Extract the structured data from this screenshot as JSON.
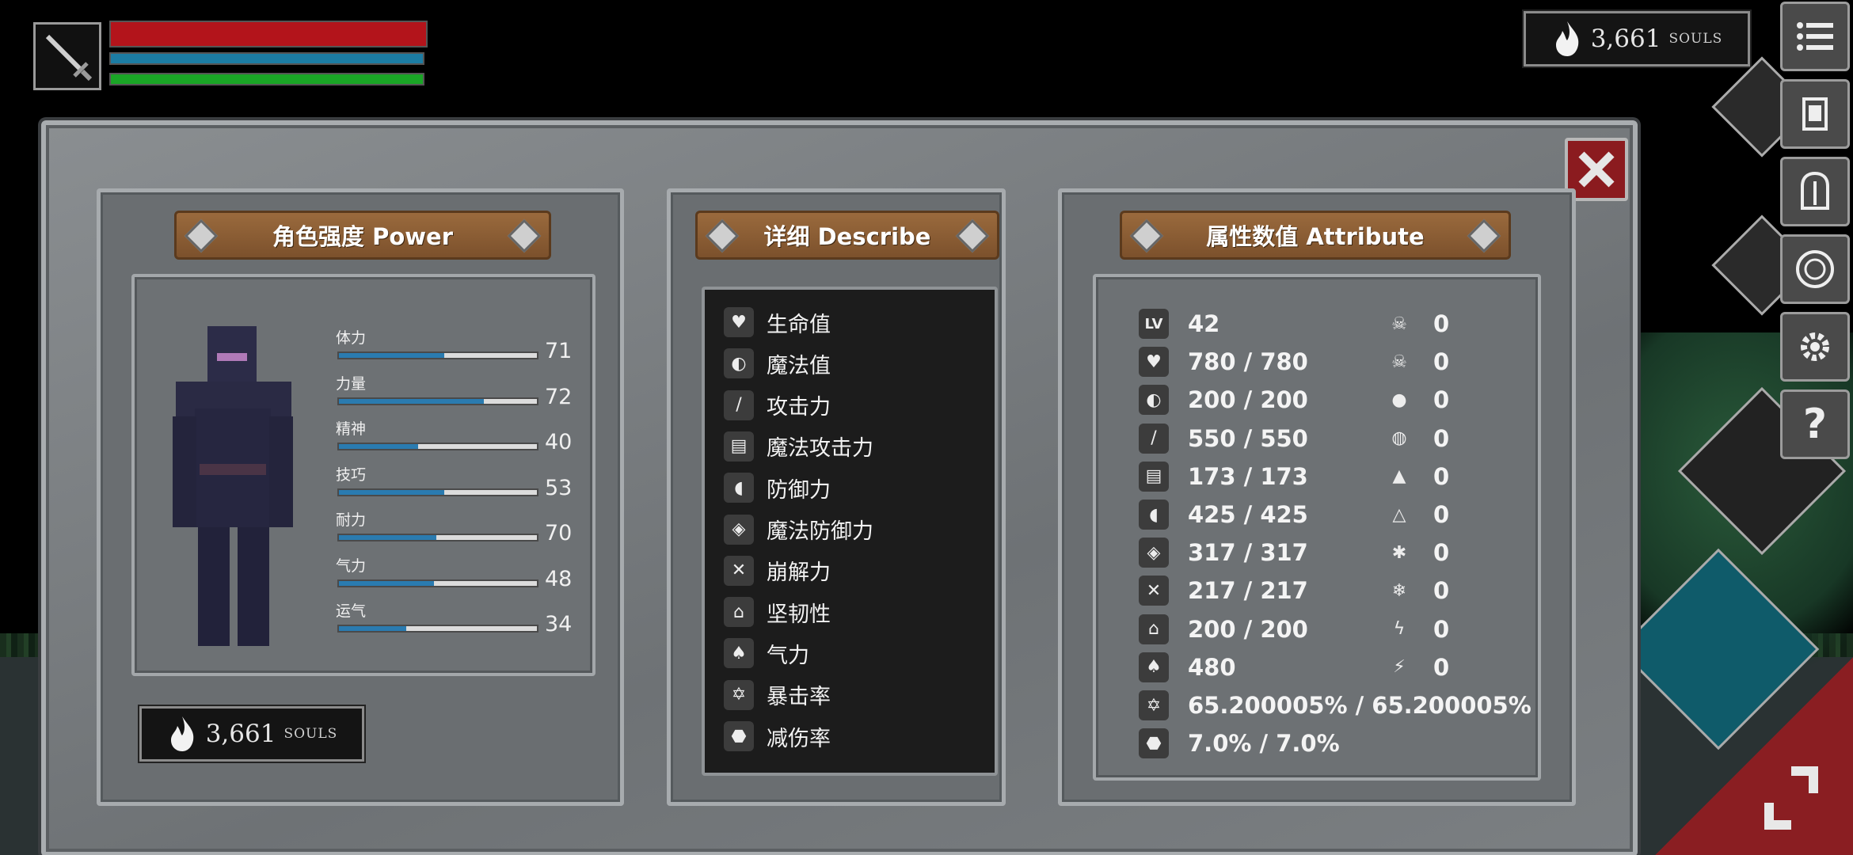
{
  "souls": {
    "value": "3,661",
    "label": "SOULS"
  },
  "hud": {
    "hp_fraction": 1.0,
    "mp_fraction": 1.0,
    "sp_fraction": 1.0
  },
  "power_panel": {
    "title": "角色强度 Power",
    "stats": [
      {
        "label": "体力",
        "value": "71",
        "fill": 0.53
      },
      {
        "label": "力量",
        "value": "72",
        "fill": 0.73
      },
      {
        "label": "精神",
        "value": "40",
        "fill": 0.4
      },
      {
        "label": "技巧",
        "value": "53",
        "fill": 0.53
      },
      {
        "label": "耐力",
        "value": "70",
        "fill": 0.49
      },
      {
        "label": "气力",
        "value": "48",
        "fill": 0.48
      },
      {
        "label": "运气",
        "value": "34",
        "fill": 0.34
      }
    ]
  },
  "describe_panel": {
    "title": "详细 Describe",
    "items": [
      {
        "icon": "heart-icon",
        "label": "生命值"
      },
      {
        "icon": "head-icon",
        "label": "魔法值"
      },
      {
        "icon": "sword-icon",
        "label": "攻击力"
      },
      {
        "icon": "magic-book-icon",
        "label": "魔法攻击力"
      },
      {
        "icon": "shield-icon",
        "label": "防御力"
      },
      {
        "icon": "magic-shield-icon",
        "label": "魔法防御力"
      },
      {
        "icon": "break-icon",
        "label": "崩解力"
      },
      {
        "icon": "helmet-icon",
        "label": "坚韧性"
      },
      {
        "icon": "lungs-icon",
        "label": "气力"
      },
      {
        "icon": "crit-star-icon",
        "label": "暴击率"
      },
      {
        "icon": "damage-reduction-icon",
        "label": "减伤率"
      }
    ]
  },
  "attribute_panel": {
    "title": "属性数值 Attribute",
    "left": [
      {
        "icon": "level-icon",
        "icon_text": "LV",
        "value": "42"
      },
      {
        "icon": "heart-icon",
        "value": "780 / 780"
      },
      {
        "icon": "head-icon",
        "value": "200 / 200"
      },
      {
        "icon": "sword-icon",
        "value": "550 / 550"
      },
      {
        "icon": "magic-book-icon",
        "value": "173 / 173"
      },
      {
        "icon": "shield-icon",
        "value": "425 / 425"
      },
      {
        "icon": "magic-shield-icon",
        "value": "317 / 317"
      },
      {
        "icon": "break-icon",
        "value": "217 / 217"
      },
      {
        "icon": "helmet-icon",
        "value": "200 / 200"
      },
      {
        "icon": "lungs-icon",
        "value": "480"
      },
      {
        "icon": "crit-star-icon",
        "value": "65.200005% / 65.200005%"
      },
      {
        "icon": "damage-reduction-icon",
        "value": "7.0% / 7.0%"
      }
    ],
    "right": [
      {
        "icon": "skull-icon",
        "value": "0"
      },
      {
        "icon": "poison-skull-icon",
        "value": "0"
      },
      {
        "icon": "bleed-drop-icon",
        "value": "0"
      },
      {
        "icon": "bleed-resist-icon",
        "value": "0"
      },
      {
        "icon": "fire-icon",
        "value": "0"
      },
      {
        "icon": "fire-resist-icon",
        "value": "0"
      },
      {
        "icon": "frost-icon",
        "value": "0"
      },
      {
        "icon": "frost-resist-icon",
        "value": "0"
      },
      {
        "icon": "lightning-icon",
        "value": "0"
      },
      {
        "icon": "lightning-resist-icon",
        "value": "0"
      }
    ]
  },
  "menu": [
    {
      "icon": "list-menu-icon"
    },
    {
      "icon": "scroll-icon"
    },
    {
      "icon": "helmet-icon"
    },
    {
      "icon": "rune-icon"
    },
    {
      "icon": "gear-icon"
    },
    {
      "icon": "help-icon",
      "text": "?"
    }
  ],
  "colors": {
    "hp": "#b3141b",
    "mp": "#1c7ca3",
    "sp": "#1aa526",
    "plank": "#8a5c33",
    "close": "#8b1b1f",
    "stat_fill": "#2a7bb0"
  }
}
